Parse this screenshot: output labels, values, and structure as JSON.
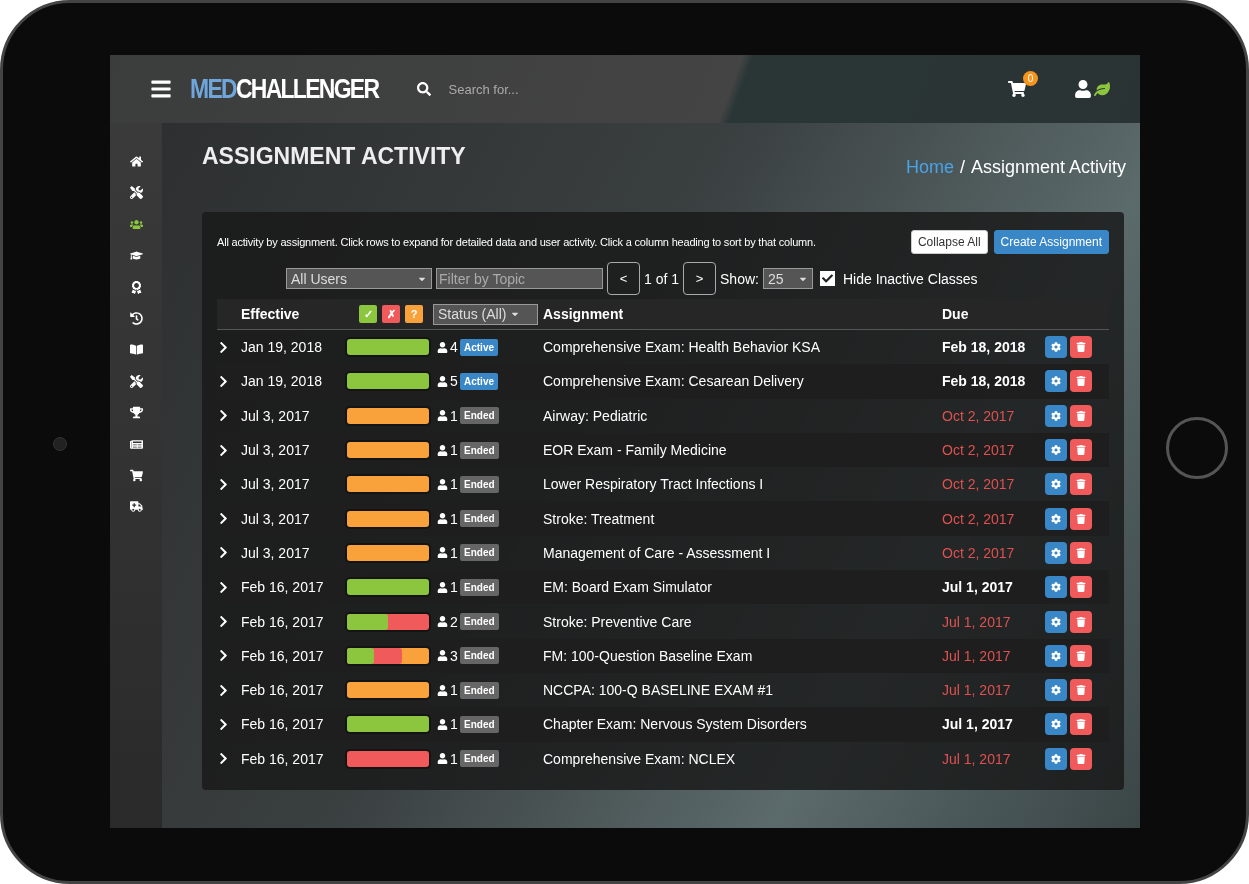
{
  "header": {
    "logo": {
      "prefix": "MED",
      "name": "CHALLENGER"
    },
    "search": {
      "placeholder": "Search for..."
    },
    "cart_count": "0"
  },
  "sidebar": {
    "items": [
      {
        "selected": false
      },
      {
        "selected": false
      },
      {
        "selected": true
      },
      {
        "selected": false
      },
      {
        "selected": false
      },
      {
        "selected": false
      },
      {
        "selected": false
      },
      {
        "selected": false
      },
      {
        "selected": false
      },
      {
        "selected": false
      },
      {
        "selected": false
      },
      {
        "selected": false
      }
    ]
  },
  "page_title": "ASSIGNMENT ACTIVITY",
  "breadcrumb": [
    {
      "label": "Home",
      "link": true
    },
    {
      "label": "/",
      "link": false
    },
    {
      "label": "Assignment Activity",
      "link": false
    }
  ],
  "panel": {
    "description": "All activity by assignment. Click rows to expand for detailed data and user activity. Click a column heading to sort by that column.",
    "buttons": [
      {
        "label": "Collapse All",
        "kind": "light"
      },
      {
        "label": "Create Assignment",
        "kind": "primary"
      }
    ],
    "filters": {
      "users": "All Users",
      "topic_placeholder": "Filter by Topic",
      "prev": "<",
      "page": "1 of 1",
      "next": ">",
      "show_label": "Show:",
      "show_value": "25",
      "hide_inactive": {
        "label": "Hide Inactive Classes",
        "checked": true
      }
    },
    "columns": {
      "effective": "Effective",
      "score_filters": [
        {
          "label": "✓",
          "color": "#8cc63f"
        },
        {
          "label": "✗",
          "color": "#f05a5a"
        },
        {
          "label": "?",
          "color": "#f9a13a"
        }
      ],
      "status": "Status (All)",
      "assignment": "Assignment",
      "due": "Due"
    },
    "rows": [
      {
        "effective": "Jan 19, 2018",
        "segments": [
          {
            "color": "#8cc63f",
            "level": 1
          }
        ],
        "users": "4",
        "status": "Active",
        "kind": "active",
        "assignment": "Comprehensive Exam: Health Behavior KSA",
        "due": "Feb 18, 2018",
        "overdue": false
      },
      {
        "effective": "Jan 19, 2018",
        "segments": [
          {
            "color": "#8cc63f",
            "level": 1
          }
        ],
        "users": "5",
        "status": "Active",
        "kind": "active",
        "assignment": "Comprehensive Exam: Cesarean Delivery",
        "due": "Feb 18, 2018",
        "overdue": false
      },
      {
        "effective": "Jul 3, 2017",
        "segments": [
          {
            "color": "#f9a13a",
            "level": 1
          }
        ],
        "users": "1",
        "status": "Ended",
        "kind": "ended",
        "assignment": "Airway: Pediatric",
        "due": "Oct 2, 2017",
        "overdue": true
      },
      {
        "effective": "Jul 3, 2017",
        "segments": [
          {
            "color": "#f9a13a",
            "level": 1
          }
        ],
        "users": "1",
        "status": "Ended",
        "kind": "ended",
        "assignment": "EOR Exam - Family Medicine",
        "due": "Oct 2, 2017",
        "overdue": true
      },
      {
        "effective": "Jul 3, 2017",
        "segments": [
          {
            "color": "#f9a13a",
            "level": 1
          }
        ],
        "users": "1",
        "status": "Ended",
        "kind": "ended",
        "assignment": "Lower Respiratory Tract Infections I",
        "due": "Oct 2, 2017",
        "overdue": true
      },
      {
        "effective": "Jul 3, 2017",
        "segments": [
          {
            "color": "#f9a13a",
            "level": 1
          }
        ],
        "users": "1",
        "status": "Ended",
        "kind": "ended",
        "assignment": "Stroke: Treatment",
        "due": "Oct 2, 2017",
        "overdue": true
      },
      {
        "effective": "Jul 3, 2017",
        "segments": [
          {
            "color": "#f9a13a",
            "level": 1
          }
        ],
        "users": "1",
        "status": "Ended",
        "kind": "ended",
        "assignment": "Management of Care - Assessment I",
        "due": "Oct 2, 2017",
        "overdue": true
      },
      {
        "effective": "Feb 16, 2017",
        "segments": [
          {
            "color": "#8cc63f",
            "level": 1
          }
        ],
        "users": "1",
        "status": "Ended",
        "kind": "ended",
        "assignment": "EM: Board Exam Simulator",
        "due": "Jul 1, 2017",
        "overdue": false
      },
      {
        "effective": "Feb 16, 2017",
        "segments": [
          {
            "color": "#8cc63f",
            "level": 0.5
          },
          {
            "color": "#f05a5a",
            "level": 1
          }
        ],
        "users": "2",
        "status": "Ended",
        "kind": "ended",
        "assignment": "Stroke: Preventive Care",
        "due": "Jul 1, 2017",
        "overdue": true
      },
      {
        "effective": "Feb 16, 2017",
        "segments": [
          {
            "color": "#8cc63f",
            "level": 0.333
          },
          {
            "color": "#f05a5a",
            "level": 0.667
          },
          {
            "color": "#f9a13a",
            "level": 1
          }
        ],
        "users": "3",
        "status": "Ended",
        "kind": "ended",
        "assignment": "FM: 100-Question Baseline Exam",
        "due": "Jul 1, 2017",
        "overdue": true
      },
      {
        "effective": "Feb 16, 2017",
        "segments": [
          {
            "color": "#f9a13a",
            "level": 1
          }
        ],
        "users": "1",
        "status": "Ended",
        "kind": "ended",
        "assignment": "NCCPA: 100-Q BASELINE EXAM #1",
        "due": "Jul 1, 2017",
        "overdue": true
      },
      {
        "effective": "Feb 16, 2017",
        "segments": [
          {
            "color": "#8cc63f",
            "level": 1
          }
        ],
        "users": "1",
        "status": "Ended",
        "kind": "ended",
        "assignment": "Chapter Exam: Nervous System Disorders",
        "due": "Jul 1, 2017",
        "overdue": false
      },
      {
        "effective": "Feb 16, 2017",
        "segments": [
          {
            "color": "#f05a5a",
            "level": 1
          }
        ],
        "users": "1",
        "status": "Ended",
        "kind": "ended",
        "assignment": "Comprehensive Exam: NCLEX",
        "due": "Jul 1, 2017",
        "overdue": true
      }
    ]
  }
}
